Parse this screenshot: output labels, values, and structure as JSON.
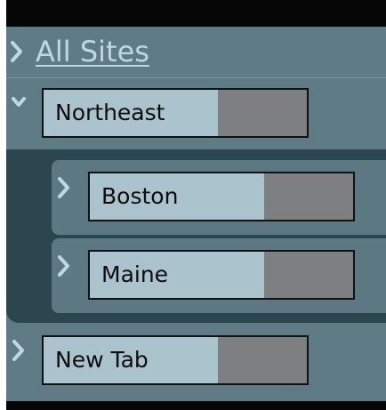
{
  "header": {
    "all_sites_label": "All Sites"
  },
  "tree": {
    "northeast": {
      "label": "Northeast",
      "expanded": true
    },
    "boston": {
      "label": "Boston"
    },
    "maine": {
      "label": "Maine"
    },
    "newtab": {
      "label": "New Tab"
    }
  },
  "colors": {
    "panel": "#5e7a84",
    "topbar": "#050505",
    "node_fill": "#aac3cd",
    "node_gray": "#7d7f80",
    "accent_text": "#bdd8e2"
  },
  "icons": {
    "collapsed": "chevron-right-icon",
    "expanded": "chevron-down-icon"
  }
}
